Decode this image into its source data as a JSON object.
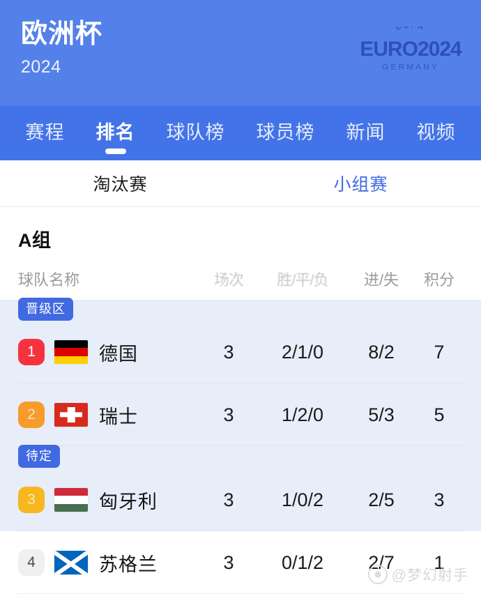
{
  "header": {
    "title": "欧洲杯",
    "subtitle": "2024",
    "logo": {
      "uefa": "UEFA",
      "euro": "EURO",
      "year": "2024",
      "country": "GERMANY"
    },
    "bg_color": "#5480ea"
  },
  "nav": {
    "bg_color": "#4273e8",
    "items": [
      {
        "label": "赛程",
        "active": false
      },
      {
        "label": "排名",
        "active": true
      },
      {
        "label": "球队榜",
        "active": false
      },
      {
        "label": "球员榜",
        "active": false
      },
      {
        "label": "新闻",
        "active": false
      },
      {
        "label": "视频",
        "active": false
      }
    ]
  },
  "subtabs": {
    "active_color": "#4169e1",
    "items": [
      {
        "label": "淘汰赛",
        "active": false
      },
      {
        "label": "小组赛",
        "active": true
      }
    ]
  },
  "group": {
    "title": "A组",
    "columns": {
      "team": "球队名称",
      "played": "场次",
      "wdl": "胜/平/负",
      "goals": "进/失",
      "points": "积分"
    },
    "zones": [
      {
        "label": "晋级区",
        "color": "#4169e1",
        "before_rank": 1
      },
      {
        "label": "待定",
        "color": "#4169e1",
        "before_rank": 3
      }
    ],
    "rows": [
      {
        "rank": "1",
        "rank_style": "rank-1",
        "flag": "germany-flag",
        "team": "德国",
        "played": "3",
        "wdl": "2/1/0",
        "goals": "8/2",
        "points": "7",
        "tinted": true
      },
      {
        "rank": "2",
        "rank_style": "rank-2",
        "flag": "switzerland-flag",
        "team": "瑞士",
        "played": "3",
        "wdl": "1/2/0",
        "goals": "5/3",
        "points": "5",
        "tinted": true
      },
      {
        "rank": "3",
        "rank_style": "rank-3",
        "flag": "hungary-flag",
        "team": "匈牙利",
        "played": "3",
        "wdl": "1/0/2",
        "goals": "2/5",
        "points": "3",
        "tinted": true
      },
      {
        "rank": "4",
        "rank_style": "rank-4",
        "flag": "scotland-flag",
        "team": "苏格兰",
        "played": "3",
        "wdl": "0/1/2",
        "goals": "2/7",
        "points": "1",
        "tinted": false
      }
    ]
  },
  "watermark": {
    "text": "@梦幻射手"
  }
}
